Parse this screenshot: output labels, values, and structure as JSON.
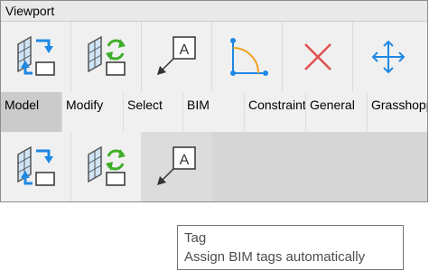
{
  "window": {
    "title": "Viewport"
  },
  "toolbar_row1": [
    {
      "icon": "bim-tag-transfer-icon"
    },
    {
      "icon": "bim-update-sync-icon"
    },
    {
      "icon": "tag-icon"
    },
    {
      "icon": "constraint-arc-icon"
    },
    {
      "icon": "delete-x-icon"
    },
    {
      "icon": "move-arrows-icon"
    }
  ],
  "tabs": [
    {
      "label": "Model"
    },
    {
      "label": "Modify"
    },
    {
      "label": "Select"
    },
    {
      "label": "BIM"
    },
    {
      "label": "Constraints"
    },
    {
      "label": "General"
    },
    {
      "label": "Grasshopper"
    }
  ],
  "toolbar_row3": [
    {
      "icon": "bim-tag-transfer-icon"
    },
    {
      "icon": "bim-update-sync-icon"
    },
    {
      "icon": "tag-icon"
    }
  ],
  "tooltip": {
    "title": "Tag",
    "description": "Assign BIM tags automatically"
  },
  "colors": {
    "accent_blue": "#1e88e5",
    "sync_green": "#3fae29",
    "delete_red": "#e05050",
    "constraint_orange": "#f0a020"
  }
}
